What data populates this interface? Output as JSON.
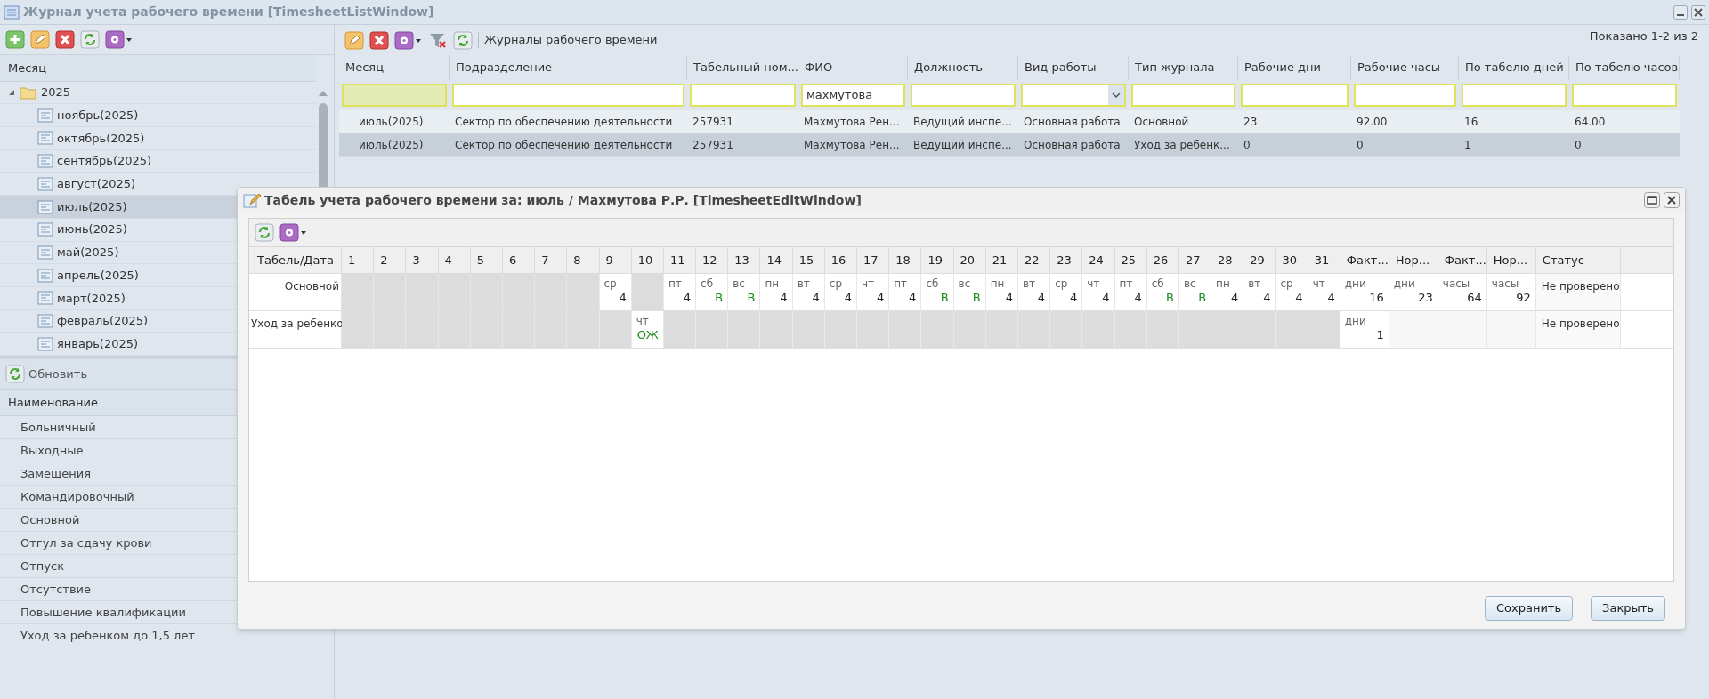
{
  "window": {
    "title": "Журнал учета рабочего времени [TimesheetListWindow]"
  },
  "month_tree": {
    "header": "Месяц",
    "root": {
      "label": "2025",
      "expanded": true,
      "children": [
        {
          "label": "ноябрь(2025)",
          "selected": false
        },
        {
          "label": "октябрь(2025)",
          "selected": false
        },
        {
          "label": "сентябрь(2025)",
          "selected": false
        },
        {
          "label": "август(2025)",
          "selected": false
        },
        {
          "label": "июль(2025)",
          "selected": true
        },
        {
          "label": "июнь(2025)",
          "selected": false
        },
        {
          "label": "май(2025)",
          "selected": false
        },
        {
          "label": "апрель(2025)",
          "selected": false
        },
        {
          "label": "март(2025)",
          "selected": false
        },
        {
          "label": "февраль(2025)",
          "selected": false
        },
        {
          "label": "январь(2025)",
          "selected": false
        }
      ]
    }
  },
  "refresh_button": "Обновить",
  "types_list": {
    "header": "Наименование",
    "items": [
      "Больничный",
      "Выходные",
      "Замещения",
      "Командировочный",
      "Основной",
      "Отгул за сдачу крови",
      "Отпуск",
      "Отсутствие",
      "Повышение квалификации",
      "Уход за ребенком до 1,5 лет"
    ]
  },
  "journal": {
    "title": "Журналы рабочего времени",
    "paging": "Показано 1-2 из 2",
    "columns": [
      "Месяц",
      "Подразделение",
      "Табельный ном...",
      "ФИО",
      "Должность",
      "Вид работы",
      "Тип журнала",
      "Рабочие дни",
      "Рабочие часы",
      "По табелю дней",
      "По табелю часов"
    ],
    "filters": [
      {
        "kind": "active"
      },
      {
        "kind": "text"
      },
      {
        "kind": "text"
      },
      {
        "kind": "text",
        "value": "махмутова"
      },
      {
        "kind": "text"
      },
      {
        "kind": "combo"
      },
      {
        "kind": "text"
      },
      {
        "kind": "text"
      },
      {
        "kind": "text"
      },
      {
        "kind": "text"
      },
      {
        "kind": "text"
      }
    ],
    "rows": [
      {
        "selected": false,
        "cells": [
          "июль(2025)",
          "Сектор по обеспечению деятельности",
          "257931",
          "Махмутова Рен...",
          "Ведущий инспе...",
          "Основная работа",
          "Основной",
          "23",
          "92.00",
          "16",
          "64.00"
        ]
      },
      {
        "selected": true,
        "cells": [
          "июль(2025)",
          "Сектор по обеспечению деятельности",
          "257931",
          "Махмутова Рен...",
          "Ведущий инспе...",
          "Основная работа",
          "Уход за ребенк...",
          "0",
          "0",
          "1",
          "0"
        ]
      }
    ]
  },
  "edit_window": {
    "title": "Табель учета рабочего времени за: июль / Махмутова Р.Р. [TimesheetEditWindow]",
    "columns": [
      "Табель/Дата",
      "1",
      "2",
      "3",
      "4",
      "5",
      "6",
      "7",
      "8",
      "9",
      "10",
      "11",
      "12",
      "13",
      "14",
      "15",
      "16",
      "17",
      "18",
      "19",
      "20",
      "21",
      "22",
      "23",
      "24",
      "25",
      "26",
      "27",
      "28",
      "29",
      "30",
      "31",
      "Факт...",
      "Нор...",
      "Факт...",
      "Нор...",
      "Статус"
    ],
    "rows": [
      {
        "label": "Основной",
        "days": [
          {
            "kind": "blank"
          },
          {
            "kind": "blank"
          },
          {
            "kind": "blank"
          },
          {
            "kind": "blank"
          },
          {
            "kind": "blank"
          },
          {
            "kind": "blank"
          },
          {
            "kind": "blank"
          },
          {
            "kind": "blank"
          },
          {
            "kind": "work",
            "weekday": "ср",
            "value": "4"
          },
          {
            "kind": "blank"
          },
          {
            "kind": "work",
            "weekday": "пт",
            "value": "4"
          },
          {
            "kind": "off",
            "weekday": "сб",
            "value": "В"
          },
          {
            "kind": "off",
            "weekday": "вс",
            "value": "В"
          },
          {
            "kind": "work",
            "weekday": "пн",
            "value": "4"
          },
          {
            "kind": "work",
            "weekday": "вт",
            "value": "4"
          },
          {
            "kind": "work",
            "weekday": "ср",
            "value": "4"
          },
          {
            "kind": "work",
            "weekday": "чт",
            "value": "4"
          },
          {
            "kind": "work",
            "weekday": "пт",
            "value": "4"
          },
          {
            "kind": "off",
            "weekday": "сб",
            "value": "В"
          },
          {
            "kind": "off",
            "weekday": "вс",
            "value": "В"
          },
          {
            "kind": "work",
            "weekday": "пн",
            "value": "4"
          },
          {
            "kind": "work",
            "weekday": "вт",
            "value": "4"
          },
          {
            "kind": "work",
            "weekday": "ср",
            "value": "4"
          },
          {
            "kind": "work",
            "weekday": "чт",
            "value": "4"
          },
          {
            "kind": "work",
            "weekday": "пт",
            "value": "4"
          },
          {
            "kind": "off",
            "weekday": "сб",
            "value": "В"
          },
          {
            "kind": "off",
            "weekday": "вс",
            "value": "В"
          },
          {
            "kind": "work",
            "weekday": "пн",
            "value": "4"
          },
          {
            "kind": "work",
            "weekday": "вт",
            "value": "4"
          },
          {
            "kind": "work",
            "weekday": "ср",
            "value": "4"
          },
          {
            "kind": "work",
            "weekday": "чт",
            "value": "4"
          }
        ],
        "totals": [
          {
            "kind": "value",
            "unit": "дни",
            "value": "16"
          },
          {
            "kind": "value",
            "unit": "дни",
            "value": "23"
          },
          {
            "kind": "value",
            "unit": "часы",
            "value": "64"
          },
          {
            "kind": "value",
            "unit": "часы",
            "value": "92"
          }
        ],
        "status": "Не проверено"
      },
      {
        "label": "Уход за ребенко",
        "days": [
          {
            "kind": "blank"
          },
          {
            "kind": "blank"
          },
          {
            "kind": "blank"
          },
          {
            "kind": "blank"
          },
          {
            "kind": "blank"
          },
          {
            "kind": "blank"
          },
          {
            "kind": "blank"
          },
          {
            "kind": "blank"
          },
          {
            "kind": "blank"
          },
          {
            "kind": "off",
            "weekday": "чт",
            "value": "ОЖ"
          },
          {
            "kind": "blank"
          },
          {
            "kind": "blank"
          },
          {
            "kind": "blank"
          },
          {
            "kind": "blank"
          },
          {
            "kind": "blank"
          },
          {
            "kind": "blank"
          },
          {
            "kind": "blank"
          },
          {
            "kind": "blank"
          },
          {
            "kind": "blank"
          },
          {
            "kind": "blank"
          },
          {
            "kind": "blank"
          },
          {
            "kind": "blank"
          },
          {
            "kind": "blank"
          },
          {
            "kind": "blank"
          },
          {
            "kind": "blank"
          },
          {
            "kind": "blank"
          },
          {
            "kind": "blank"
          },
          {
            "kind": "blank"
          },
          {
            "kind": "blank"
          },
          {
            "kind": "blank"
          },
          {
            "kind": "blank"
          }
        ],
        "totals": [
          {
            "kind": "value",
            "unit": "дни",
            "value": "1"
          },
          {
            "kind": "empty"
          },
          {
            "kind": "empty"
          },
          {
            "kind": "empty"
          }
        ],
        "status": "Не проверено"
      }
    ]
  },
  "buttons": [
    "Сохранить",
    "Закрыть"
  ]
}
